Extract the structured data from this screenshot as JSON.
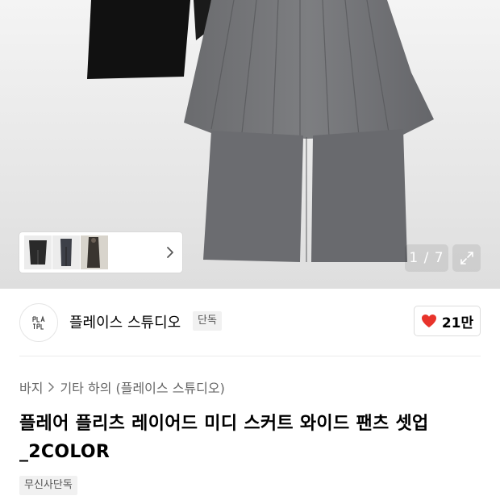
{
  "gallery": {
    "current_index": 1,
    "total": 7,
    "counter_text": "1 / 7",
    "expand_icon": "expand-icon",
    "thumbnail_next_icon": "chevron-right-icon"
  },
  "brand": {
    "logo_alt": "brand-logo",
    "name": "플레이스 스튜디오",
    "badge": "단독"
  },
  "like": {
    "icon": "heart-icon",
    "icon_color": "#e8332b",
    "count": "21만"
  },
  "breadcrumb": {
    "items": [
      "바지",
      "기타 하의 (플레이스 스튜디오)"
    ]
  },
  "product": {
    "title": "플레어 플리츠 레이어드 미디 스커트 와이드 팬츠 셋업_2COLOR",
    "tag": "무신사단독"
  }
}
